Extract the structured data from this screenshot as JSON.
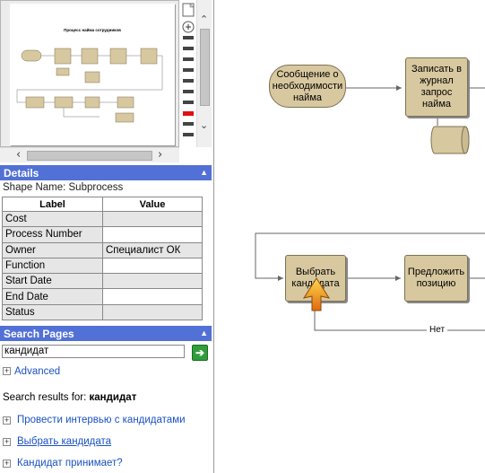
{
  "details": {
    "header": "Details",
    "shape_name": "Shape Name: Subprocess",
    "columns": [
      "Label",
      "Value"
    ],
    "rows": [
      {
        "label": "Cost",
        "value": ""
      },
      {
        "label": "Process Number",
        "value": ""
      },
      {
        "label": "Owner",
        "value": "Специалист ОК"
      },
      {
        "label": "Function",
        "value": ""
      },
      {
        "label": "Start Date",
        "value": ""
      },
      {
        "label": "End Date",
        "value": ""
      },
      {
        "label": "Status",
        "value": ""
      }
    ]
  },
  "thumbnail": {
    "title": "Процесс найма сотрудников"
  },
  "search": {
    "header": "Search Pages",
    "query": "кандидат",
    "advanced_label": "Advanced",
    "results_prefix": "Search results for:",
    "results_term": "кандидат",
    "results": [
      "Провести интервью с кандидатами",
      "Выбрать кандидата",
      "Кандидат принимает?"
    ]
  },
  "diagram": {
    "start_node": "Сообщение о необходимости найма",
    "node_log": "Записать в журнал запрос найма",
    "node_select": "Выбрать кандидата",
    "node_offer": "Предложить позицию",
    "edge_no": "Нет"
  },
  "colors": {
    "shape_fill": "#d8c89f",
    "header_blue": "#5271d6",
    "link_blue": "#1a52c2"
  }
}
